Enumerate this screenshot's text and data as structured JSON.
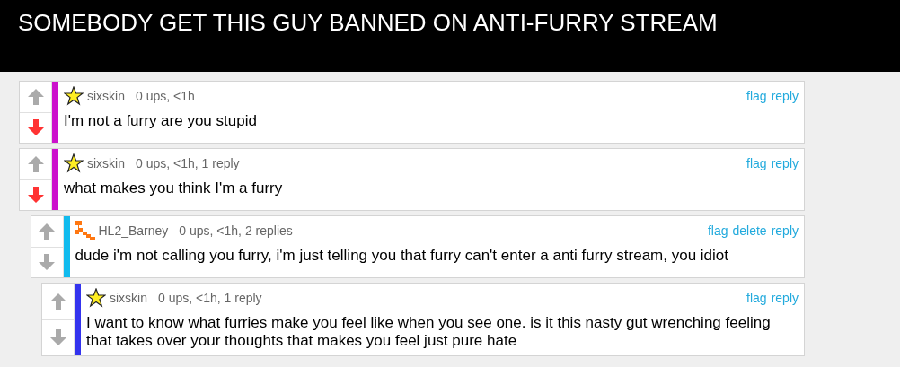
{
  "caption": "SOMEBODY GET THIS GUY BANNED ON ANTI-FURRY STREAM",
  "comments": [
    {
      "kind": "star",
      "user": "sixskin",
      "meta": "0 ups, <1h",
      "color": "#cc11cc",
      "upvoted": false,
      "downvoted": true,
      "text": "I'm not a furry are you stupid",
      "actions": [
        "flag",
        "reply"
      ]
    },
    {
      "kind": "star",
      "user": "sixskin",
      "meta": "0 ups, <1h, 1 reply",
      "color": "#cc11cc",
      "upvoted": false,
      "downvoted": true,
      "text": "what makes you think I'm a furry",
      "actions": [
        "flag",
        "reply"
      ],
      "children": [
        {
          "kind": "pixel",
          "user": "HL2_Barney",
          "meta": "0 ups, <1h, 2 replies",
          "color": "#11bbee",
          "upvoted": false,
          "downvoted": false,
          "text": "dude i'm not calling you furry, i'm just telling you that furry can't enter a anti furry stream, you idiot",
          "actions": [
            "flag",
            "delete",
            "reply"
          ],
          "children": [
            {
              "kind": "star",
              "user": "sixskin",
              "meta": "0 ups, <1h, 1 reply",
              "color": "#3333ee",
              "upvoted": false,
              "downvoted": false,
              "text": "I want to know what furries make you feel like when you see one. is it this nasty gut wrenching feeling that takes over your thoughts that makes you feel just pure hate",
              "actions": [
                "flag",
                "reply"
              ]
            }
          ]
        }
      ]
    }
  ]
}
